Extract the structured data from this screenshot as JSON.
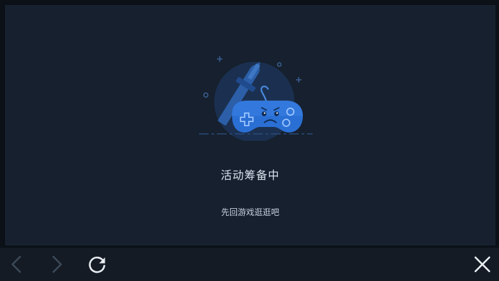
{
  "main": {
    "title": "活动筹备中",
    "subtitle": "先回游戏逛逛吧"
  },
  "toolbar": {
    "back": {
      "icon": "chevron-left-icon",
      "enabled": false
    },
    "forward": {
      "icon": "chevron-right-icon",
      "enabled": false
    },
    "refresh": {
      "icon": "refresh-icon",
      "enabled": true
    },
    "close": {
      "icon": "close-icon",
      "enabled": true
    }
  },
  "colors": {
    "background": "#0c1118",
    "panel": "#16202e",
    "accent": "#2f6fd6",
    "text": "#d9e2ee"
  }
}
